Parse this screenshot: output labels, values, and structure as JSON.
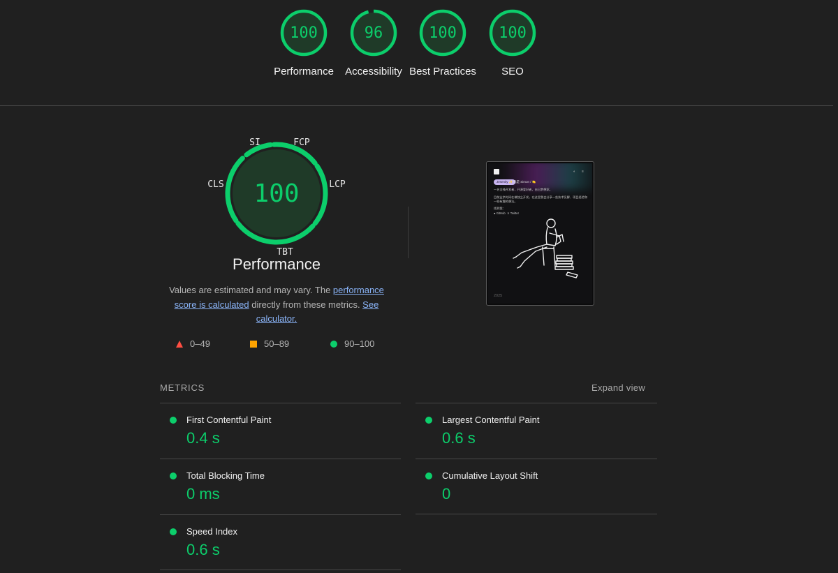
{
  "top_gauges": [
    {
      "score": "100",
      "label": "Performance",
      "fraction": 1.0
    },
    {
      "score": "96",
      "label": "Accessibility",
      "fraction": 0.96
    },
    {
      "score": "100",
      "label": "Best Practices",
      "fraction": 1.0
    },
    {
      "score": "100",
      "label": "SEO",
      "fraction": 1.0
    }
  ],
  "performance": {
    "score": "100",
    "title": "Performance",
    "segments": {
      "si": "SI",
      "fcp": "FCP",
      "lcp": "LCP",
      "tbt": "TBT",
      "cls": "CLS"
    },
    "desc_prefix": "Values are estimated and may vary. The ",
    "desc_link1": "performance score is calculated",
    "desc_middle": " directly from these metrics. ",
    "desc_link2": "See calculator."
  },
  "legend": {
    "fail": "0–49",
    "average": "50–89",
    "pass": "90–100"
  },
  "thumbnail": {
    "badge": "Jesenity ✨",
    "name": "我是 Simon / 🍋",
    "line1": "一名全栈开发者，开源爱好者，白日梦想家。",
    "line2": "目前业余时间在做独立开发，在这里我会分享一些技术见解、项目经验和一些有趣的想法。",
    "line3": "找到我：",
    "github": "GitHub",
    "twitter": "Twitter",
    "footer": "2025"
  },
  "metrics": {
    "header": "METRICS",
    "expand": "Expand view",
    "items": [
      {
        "name": "First Contentful Paint",
        "value": "0.4 s"
      },
      {
        "name": "Largest Contentful Paint",
        "value": "0.6 s"
      },
      {
        "name": "Total Blocking Time",
        "value": "0 ms"
      },
      {
        "name": "Cumulative Layout Shift",
        "value": "0"
      },
      {
        "name": "Speed Index",
        "value": "0.6 s"
      }
    ]
  },
  "colors": {
    "pass": "#0cce6b",
    "average": "#ffa400",
    "fail": "#ff4e42",
    "link": "#8ab4f8"
  }
}
